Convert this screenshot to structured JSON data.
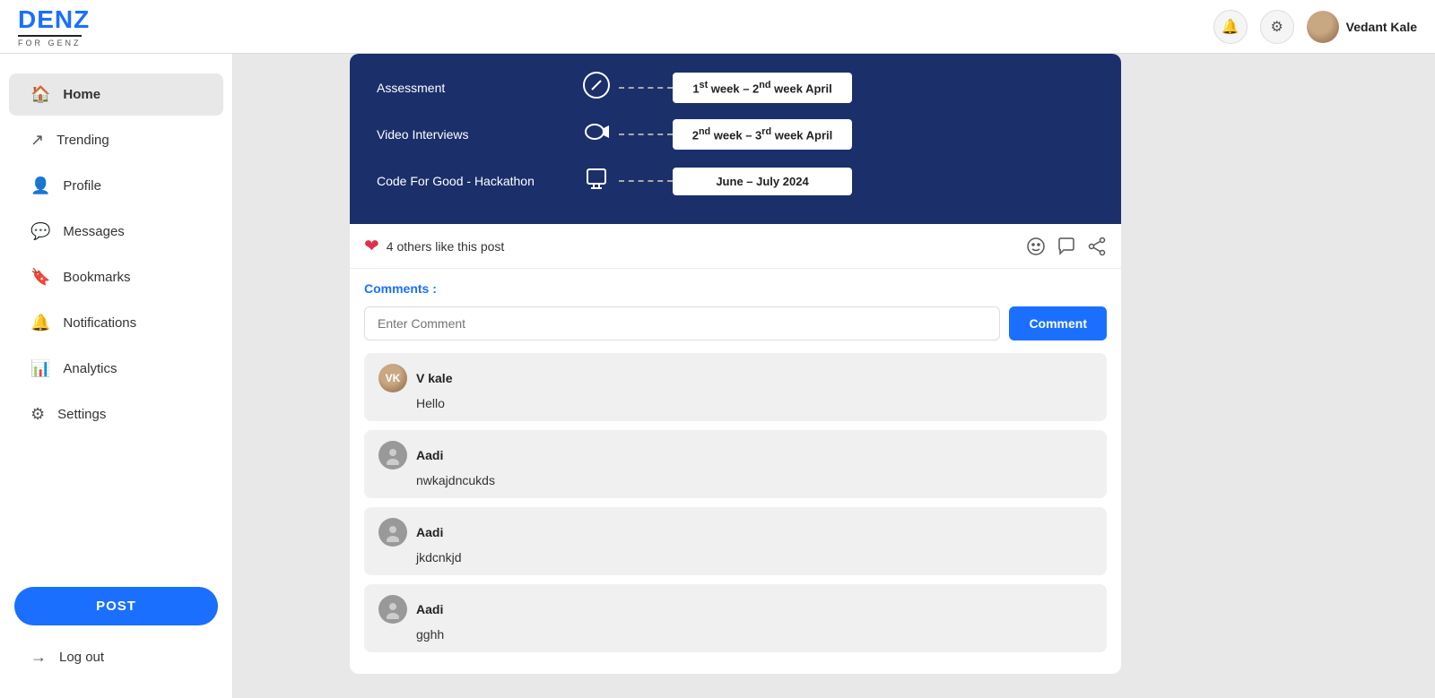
{
  "header": {
    "logo_d": "D",
    "logo_enz": "ENZ",
    "logo_sub": "FOR GENZ",
    "username": "Vedant Kale",
    "bell_icon": "🔔",
    "settings_icon": "⚙"
  },
  "sidebar": {
    "items": [
      {
        "id": "home",
        "label": "Home",
        "icon": "🏠",
        "active": true
      },
      {
        "id": "trending",
        "label": "Trending",
        "icon": "↗",
        "active": false
      },
      {
        "id": "profile",
        "label": "Profile",
        "icon": "👤",
        "active": false
      },
      {
        "id": "messages",
        "label": "Messages",
        "icon": "💬",
        "active": false
      },
      {
        "id": "bookmarks",
        "label": "Bookmarks",
        "icon": "🔖",
        "active": false
      },
      {
        "id": "notifications",
        "label": "Notifications",
        "icon": "🔔",
        "active": false
      },
      {
        "id": "analytics",
        "label": "Analytics",
        "icon": "📊",
        "active": false
      },
      {
        "id": "settings",
        "label": "Settings",
        "icon": "⚙",
        "active": false
      }
    ],
    "post_button": "POST",
    "logout_label": "Log out",
    "logout_icon": "→"
  },
  "post": {
    "timeline": {
      "rows": [
        {
          "label": "Assessment",
          "date": "1st week – 2nd week April"
        },
        {
          "label": "Video Interviews",
          "date": "2nd week – 3rd week April"
        },
        {
          "label": "Code For Good - Hackathon",
          "date": "June – July 2024"
        }
      ]
    },
    "likes_text": "4 others like this post",
    "comments_label": "Comments :",
    "comment_placeholder": "Enter Comment",
    "comment_button": "Comment"
  },
  "comments": [
    {
      "id": "c1",
      "author": "V kale",
      "text": "Hello",
      "avatar_type": "vkale"
    },
    {
      "id": "c2",
      "author": "Aadi",
      "text": "nwkajdncukds",
      "avatar_type": "aadi"
    },
    {
      "id": "c3",
      "author": "Aadi",
      "text": "jkdcnkjd",
      "avatar_type": "aadi"
    },
    {
      "id": "c4",
      "author": "Aadi",
      "text": "gghh",
      "avatar_type": "aadi"
    }
  ]
}
